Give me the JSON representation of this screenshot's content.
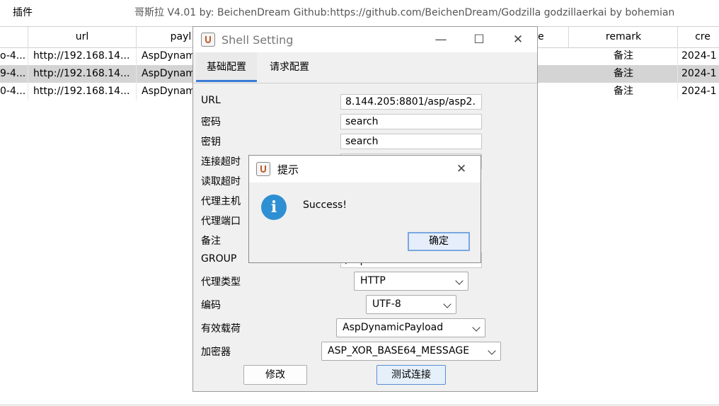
{
  "menu": {
    "plugins": "插件"
  },
  "app_title": "哥斯拉   V4.01 by: BeichenDream Github:https://github.com/BeichenDream/Godzilla   godzillaerkai by bohemian",
  "table": {
    "headers": [
      "url",
      "payl",
      "e",
      "remark",
      "cre"
    ],
    "rows": [
      {
        "id": "o-4...",
        "url": "http://192.168.14...",
        "payload": "AspDynam",
        "remark": "备注",
        "created": "2024-1"
      },
      {
        "id": "9-4...",
        "url": "http://192.168.14...",
        "payload": "AspDynam",
        "remark": "备注",
        "created": "2024-1"
      },
      {
        "id": "0-4...",
        "url": "http://192.168.14...",
        "payload": "AspDynam",
        "remark": "备注",
        "created": "2024-1"
      }
    ]
  },
  "shell_window": {
    "title": "Shell Setting",
    "tabs": [
      "基础配置",
      "请求配置"
    ],
    "labels": {
      "url": "URL",
      "password": "密码",
      "key": "密钥",
      "conn_timeout": "连接超时",
      "read_timeout": "读取超时",
      "proxy_host": "代理主机",
      "proxy_port": "代理端口",
      "remark": "备注",
      "group": "GROUP",
      "proxy_type": "代理类型",
      "encoding": "编码",
      "payload": "有效载荷",
      "cryption": "加密器"
    },
    "values": {
      "url": "8.144.205:8801/asp/asp2.",
      "password": "search",
      "key": "search",
      "group": "/asp",
      "proxy_type": "HTTP",
      "encoding": "UTF-8",
      "payload": "AspDynamicPayload",
      "cryption": "ASP_XOR_BASE64_MESSAGE"
    },
    "buttons": {
      "modify": "修改",
      "test": "测试连接"
    }
  },
  "dialog": {
    "title": "提示",
    "message": "Success!",
    "ok": "确定"
  },
  "icons": [
    "java-icon",
    "info-icon",
    "close-icon",
    "minimize-icon",
    "maximize-icon",
    "chevron-down-icon"
  ],
  "colors": {
    "accent": "#3a7bd5",
    "info": "#2f8fd3",
    "selected_row": "#d4d4d4"
  }
}
